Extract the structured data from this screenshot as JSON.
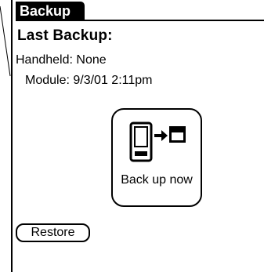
{
  "window": {
    "title": "Backup"
  },
  "status": {
    "heading": "Last Backup:",
    "handheld": "Handheld: None",
    "module": "Module: 9/3/01 2:11pm"
  },
  "actions": {
    "backup_now_label": "Back up now",
    "backup_icon": "handheld-to-module-icon",
    "restore_label": "Restore"
  }
}
